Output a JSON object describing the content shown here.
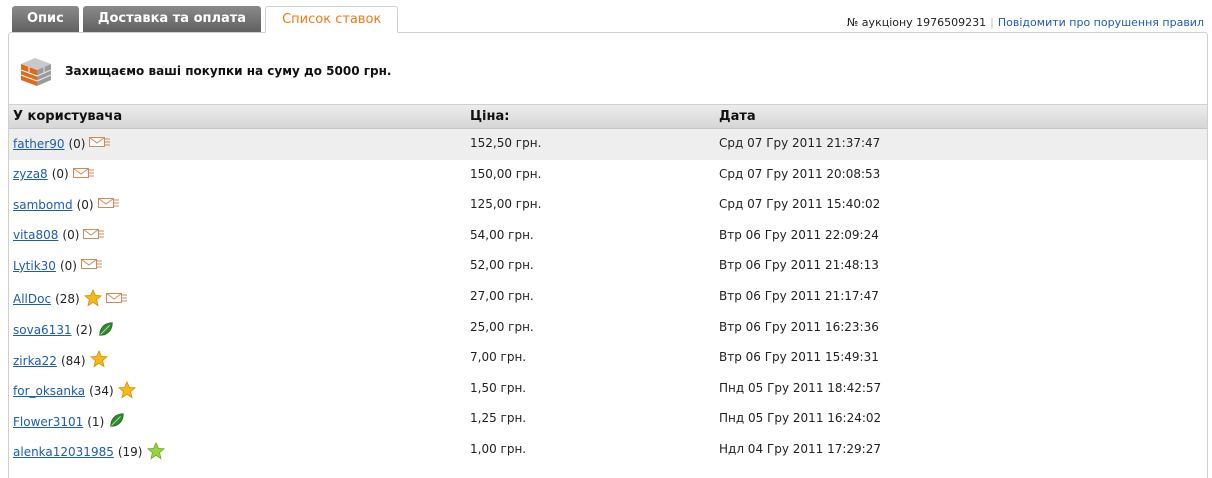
{
  "tabs": [
    {
      "label": "Опис",
      "active": false
    },
    {
      "label": "Доставка та оплата",
      "active": false
    },
    {
      "label": "Список ставок",
      "active": true
    }
  ],
  "auction": {
    "number_label": "№ аукціону 1976509231",
    "report_link": "Повідомити про порушення правил"
  },
  "protection": {
    "text": "Захищаємо ваші покупки на суму до 5000 грн."
  },
  "table": {
    "headers": [
      "У користувача",
      "Ціна:",
      "Дата"
    ],
    "rows": [
      {
        "user": "father90",
        "score": "(0)",
        "icon": "envelope-icon",
        "price": "152,50 грн.",
        "date": "Срд 07 Гру 2011 21:37:47",
        "highlight": true
      },
      {
        "user": "zyza8",
        "score": "(0)",
        "icon": "envelope-icon",
        "price": "150,00 грн.",
        "date": "Срд 07 Гру 2011 20:08:53"
      },
      {
        "user": "sambomd",
        "score": "(0)",
        "icon": "envelope-icon",
        "price": "125,00 грн.",
        "date": "Срд 07 Гру 2011 15:40:02"
      },
      {
        "user": "vita808",
        "score": "(0)",
        "icon": "envelope-icon",
        "price": "54,00 грн.",
        "date": "Втр 06 Гру 2011 22:09:24"
      },
      {
        "user": "Lytik30",
        "score": "(0)",
        "icon": "envelope-icon",
        "price": "52,00 грн.",
        "date": "Втр 06 Гру 2011 21:48:13"
      },
      {
        "user": "AllDoc",
        "score": "(28)",
        "icon": "star-envelope-icon",
        "price": "27,00 грн.",
        "date": "Втр 06 Гру 2011 21:17:47"
      },
      {
        "user": "sova6131",
        "score": "(2)",
        "icon": "leaf-icon",
        "price": "25,00 грн.",
        "date": "Втр 06 Гру 2011 16:23:36"
      },
      {
        "user": "zirka22",
        "score": "(84)",
        "icon": "star-icon",
        "price": "7,00 грн.",
        "date": "Втр 06 Гру 2011 15:49:31"
      },
      {
        "user": "for_oksanka",
        "score": "(34)",
        "icon": "star-icon",
        "price": "1,50 грн.",
        "date": "Пнд 05 Гру 2011 18:42:57"
      },
      {
        "user": "Flower3101",
        "score": "(1)",
        "icon": "leaf-icon",
        "price": "1,25 грн.",
        "date": "Пнд 05 Гру 2011 16:24:02"
      },
      {
        "user": "alenka12031985",
        "score": "(19)",
        "icon": "green-star-icon",
        "price": "1,00 грн.",
        "date": "Ндл 04 Гру 2011 17:29:27"
      }
    ]
  },
  "colors": {
    "accent_orange": "#f07a14",
    "link_blue": "#1d5bb5",
    "header_bg": "#dcdcdc",
    "highlight_row": "#eeeeee"
  }
}
